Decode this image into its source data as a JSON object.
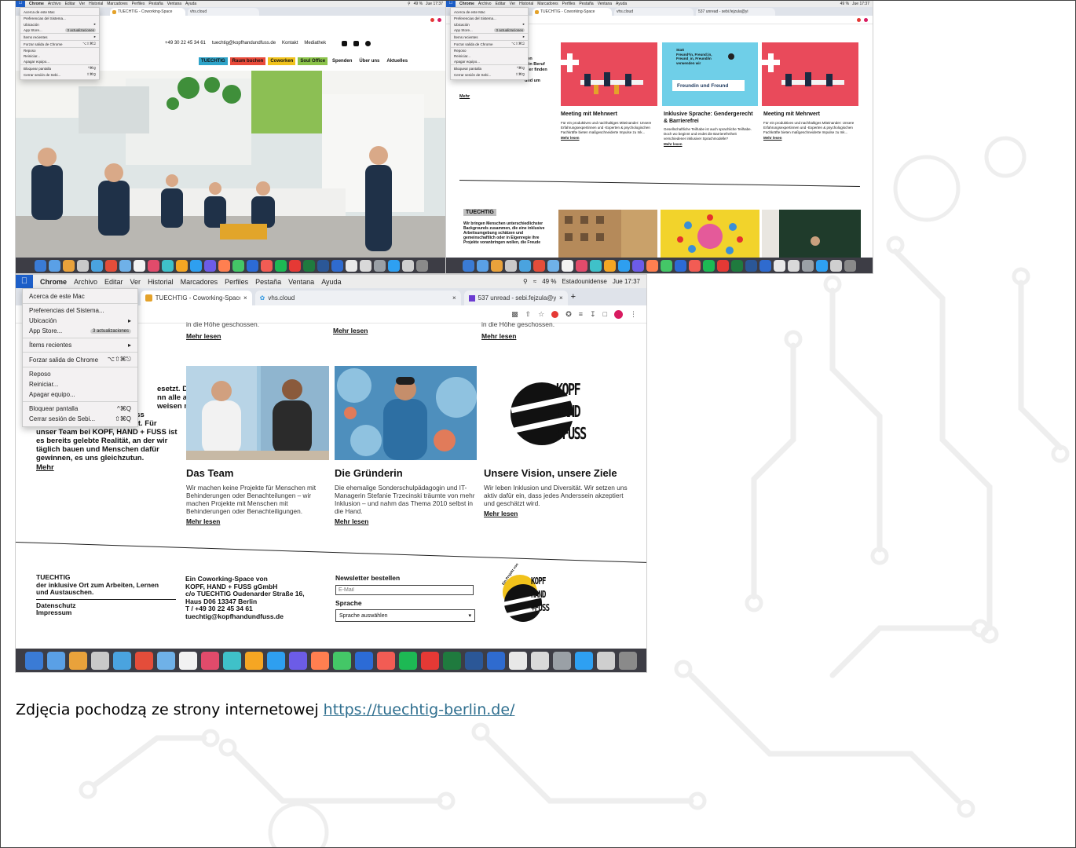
{
  "caption": {
    "text": "Zdjęcia pochodzą ze strony internetowej ",
    "link": "https://tuechtig-berlin.de/"
  },
  "mac_menu": {
    "app": "Chrome",
    "items": [
      "Archivo",
      "Editar",
      "Ver",
      "Historial",
      "Marcadores",
      "Perfiles",
      "Pestaña",
      "Ventana",
      "Ayuda"
    ],
    "status": {
      "battery": "49 %",
      "input_source": "Estadounidense",
      "clock": "Jue 17:37"
    }
  },
  "apple_menu": {
    "items": [
      {
        "label": "Acerca de este Mac",
        "shortcut": ""
      },
      {
        "label": "Preferencias del Sistema...",
        "shortcut": ""
      },
      {
        "label": "Ubicación",
        "shortcut": "▸"
      },
      {
        "label": "App Store...",
        "badge": "3 actualizaciones"
      },
      {
        "label": "Ítems recientes",
        "shortcut": "▸"
      },
      {
        "label": "Forzar salida de Chrome",
        "shortcut": "⌥⇧⌘⎋"
      },
      {
        "label": "Reposo",
        "shortcut": ""
      },
      {
        "label": "Reiniciar...",
        "shortcut": ""
      },
      {
        "label": "Apagar equipo...",
        "shortcut": ""
      },
      {
        "label": "Bloquear pantalla",
        "shortcut": "^⌘Q"
      },
      {
        "label": "Cerrar sesión de Sebi...",
        "shortcut": "⇧⌘Q"
      }
    ]
  },
  "tabs": [
    {
      "title": "TUECHTIG - Coworking-Space",
      "close": "×"
    },
    {
      "title": "vhs.cloud",
      "close": "×"
    },
    {
      "title": "537 unread - sebi.fejzula@yi",
      "close": "×"
    }
  ],
  "shot1": {
    "contact": {
      "phone": "+49 30 22 45 34 61",
      "email": "tuechtig@kopfhandundfuss.de",
      "kontakt": "Kontakt",
      "mediathek": "Mediathek"
    },
    "nav": [
      "TUECHTIG",
      "Raum buchen",
      "Coworken",
      "Soul Office",
      "Spenden",
      "Über uns",
      "Aktuelles"
    ],
    "nav_colors": [
      "#2fa4c9",
      "#e84a3a",
      "#f0c21c",
      "#8bc34a"
    ]
  },
  "shot2": {
    "left_fragment": [
      "von",
      "g in Beruf",
      "Hier finden",
      "t",
      "und um"
    ],
    "left_link": "Mehr",
    "cards": [
      {
        "title": "Meeting mit Mehrwert",
        "text": "Für ein produktives und nachhaltiges Miteinander: Unsere Erfahrungsexpertinnen und -Experten & psychologischen Fachkräfte bieten maßgeschneiderte Impulse zu Ink...",
        "link": "Mehr lesen"
      },
      {
        "title": "Inklusive Sprache: Gendergerecht & Barrierefrei",
        "text": "Gesellschaftliche Teilhabe ist auch sprachliche Teilhabe. Doch wo beginnt und endet die Barrierefreiheit verschiedener inklusiver Sprachmodelle?",
        "link": "Mehr lesen",
        "img_lines": [
          "Statt",
          "Freund*in, Freund:in,",
          "Freund_in, Freund/in",
          "verwenden wir"
        ],
        "img_label": "Freundin und Freund"
      },
      {
        "title": "Meeting mit Mehrwert",
        "text": "Für ein produktives und nachhaltiges Miteinander: Unsere Erfahrungsexpertinnen und -Experten & psychologischen Fachkräfte bieten maßgeschneiderte Impulse zu Ink...",
        "link": "Mehr lesen"
      }
    ],
    "tuechtig_badge": "TUECHTIG",
    "tuechtig_text": "Wir bringen Menschen unterschiedlichster Backgrounds zusammen, die eine inklusive Arbeitsumgebung schätzen und gemeinschaftlich oder in Eigenregie ihre Projekte voranbringen wollen, die Freude"
  },
  "shot3": {
    "top_fragment": "in die Höhe geschossen.",
    "top_links": [
      "Mehr lesen",
      "Mehr lesen",
      "Mehr lesen"
    ],
    "left_text_tail": "esetzt. Diese",
    "left_text_tail2": "nn alle an",
    "left_text_tail3": "weisen mit",
    "left_text": "unserer Arbeit jeden Tag, dass Inklusion kein Luftschloss ist. Für unser Team bei KOPF, HAND + FUSS ist es bereits gelebte Realität, an der wir täglich bauen und Menschen dafür gewinnen, es uns gleichzutun.",
    "left_link": "Mehr",
    "cards": [
      {
        "title": "Das Team",
        "text": "Wir machen keine Projekte für Menschen mit Behinderungen oder Benachteilungen – wir machen Projekte mit Menschen mit Behinderungen oder Benachteiligungen.",
        "link": "Mehr lesen"
      },
      {
        "title": "Die Gründerin",
        "text": "Die ehemalige Sonderschulpädagogin und IT-Managerin Stefanie Trzecinski träumte von mehr Inklusion – und nahm das Thema 2010 selbst in die Hand.",
        "link": "Mehr lesen"
      },
      {
        "title": "Unsere Vision, unsere Ziele",
        "text": "Wir leben Inklusion und Diversität. Wir setzen uns aktiv dafür ein, dass jedes Anderssein akzeptiert und geschätzt wird.",
        "link": "Mehr lesen"
      }
    ],
    "logo_lines": [
      "KOPF",
      "HAND",
      "+FUSS"
    ],
    "footer": {
      "col1": {
        "title": "TUECHTIG",
        "lines": [
          "der inklusive Ort zum Arbeiten, Lernen",
          "und Austauschen."
        ],
        "links": [
          "Datenschutz",
          "Impressum"
        ]
      },
      "col2": {
        "lines": [
          "Ein Coworking-Space von",
          "KOPF, HAND + FUSS gGmbH",
          "c/o TUECHTIG Oudenarder Straße 16,",
          "Haus D06 13347 Berlin",
          "T / +49 30 22 45 34 61",
          "tuechtig@kopfhandundfuss.de"
        ]
      },
      "newsletter": {
        "title": "Newsletter bestellen",
        "placeholder": "E-Mail",
        "lang_title": "Sprache",
        "lang_select": "Sprache auswählen"
      },
      "badge": "Ein Projekt von"
    }
  },
  "dock_colors": [
    "#3a7bd5",
    "#5aa0e6",
    "#e9a23b",
    "#c9c9c9",
    "#4aa3df",
    "#e44d3a",
    "#6fb1e8",
    "#f2f2f2",
    "#e14b6b",
    "#3fc1c9",
    "#f5a623",
    "#2e9ff0",
    "#6c5ce7",
    "#ff7f50",
    "#44c767",
    "#2c6bd6",
    "#f25c54",
    "#1db954",
    "#e53935",
    "#1f7a3e",
    "#2b5797",
    "#2f6bcf",
    "#e8e8e8",
    "#d9d9d9",
    "#9aa0a6",
    "#2ea0f2",
    "#cfcfcf",
    "#8a8a8a"
  ]
}
